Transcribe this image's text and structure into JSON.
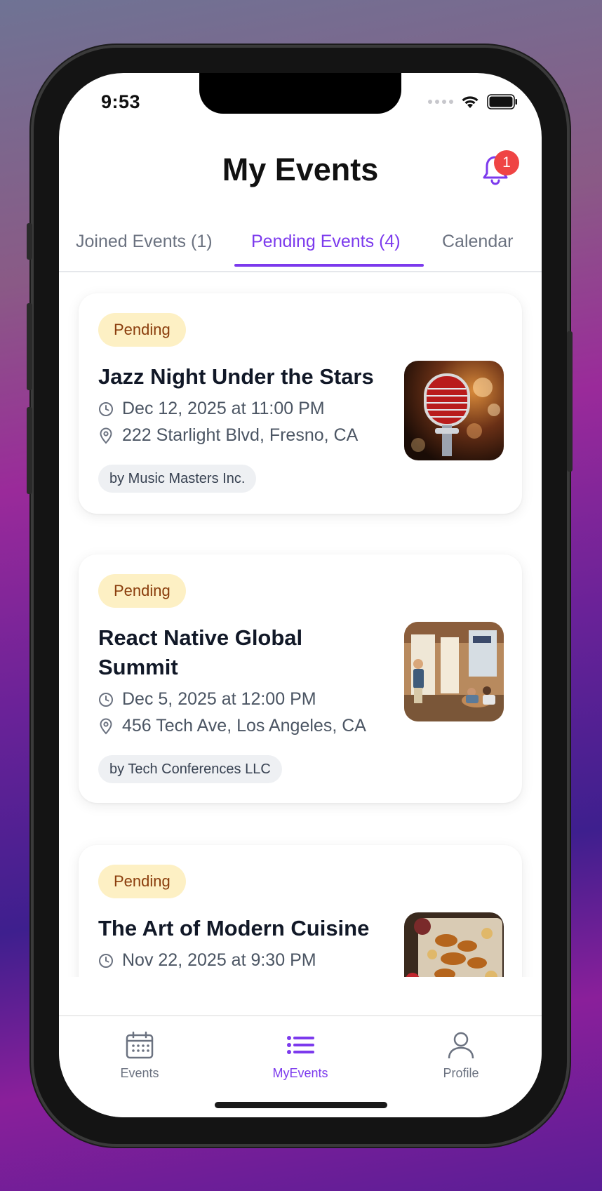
{
  "status": {
    "time": "9:53"
  },
  "header": {
    "title": "My Events",
    "notification_count": "1"
  },
  "tabs": [
    {
      "label": "Joined Events (1)"
    },
    {
      "label": "Pending Events (4)"
    },
    {
      "label": "Calendar"
    }
  ],
  "events": [
    {
      "status": "Pending",
      "title": "Jazz Night Under the Stars",
      "datetime": "Dec 12, 2025 at 11:00 PM",
      "location": "222 Starlight Blvd, Fresno, CA",
      "organizer": "by Music Masters Inc."
    },
    {
      "status": "Pending",
      "title": "React Native Global Summit",
      "datetime": "Dec 5, 2025 at 12:00 PM",
      "location": "456 Tech Ave, Los Angeles, CA",
      "organizer": "by Tech Conferences LLC"
    },
    {
      "status": "Pending",
      "title": "The Art of Modern Cuisine",
      "datetime": "Nov 22, 2025 at 9:30 PM",
      "location": "",
      "organizer": ""
    }
  ],
  "bottom_nav": [
    {
      "label": "Events",
      "icon": "calendar-icon"
    },
    {
      "label": "MyEvents",
      "icon": "list-icon"
    },
    {
      "label": "Profile",
      "icon": "user-icon"
    }
  ],
  "colors": {
    "accent": "#7c3aed",
    "pending_bg": "#fdf0c4",
    "pending_text": "#8a3d0c",
    "badge": "#ef4444"
  }
}
